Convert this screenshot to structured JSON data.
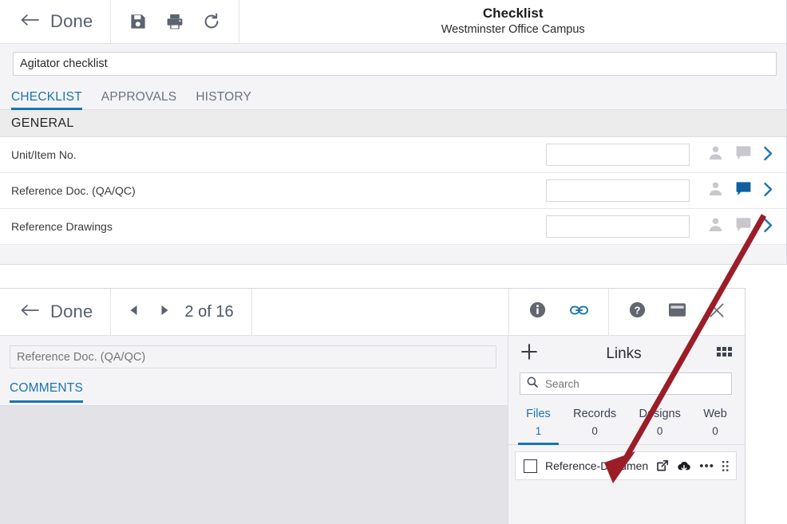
{
  "checklist_panel": {
    "toolbar": {
      "back_icon": "arrow-left-icon",
      "done_label": "Done",
      "save_icon": "save-icon",
      "print_icon": "print-icon",
      "refresh_icon": "refresh-icon"
    },
    "header": {
      "title": "Checklist",
      "subtitle": "Westminster Office Campus"
    },
    "name_field": {
      "value": "Agitator checklist",
      "placeholder": ""
    },
    "tabs": [
      {
        "label": "CHECKLIST",
        "active": true
      },
      {
        "label": "APPROVALS",
        "active": false
      },
      {
        "label": "HISTORY",
        "active": false
      }
    ],
    "section": {
      "title": "GENERAL"
    },
    "rows": [
      {
        "label": "Unit/Item No.",
        "value": "",
        "assignee_icon": "person-icon",
        "comment_icon": "comment-icon",
        "comment_active": false,
        "chevron_icon": "chevron-right-icon"
      },
      {
        "label": "Reference Doc. (QA/QC)",
        "value": "",
        "assignee_icon": "person-icon",
        "comment_icon": "comment-icon",
        "comment_active": true,
        "chevron_icon": "chevron-right-icon"
      },
      {
        "label": "Reference Drawings",
        "value": "",
        "assignee_icon": "person-icon",
        "comment_icon": "comment-icon",
        "comment_active": false,
        "chevron_icon": "chevron-right-icon"
      }
    ]
  },
  "detail_panel": {
    "toolbar": {
      "back_icon": "arrow-left-icon",
      "done_label": "Done",
      "prev_icon": "triangle-left-icon",
      "next_icon": "triangle-right-icon",
      "counter": "2 of 16",
      "info_icon": "info-icon",
      "link_icon": "link-icon",
      "help_icon": "help-icon",
      "panel_icon": "panel-icon",
      "close_icon": "close-icon"
    },
    "item_name_field": {
      "value": "",
      "placeholder": "Reference Doc. (QA/QC)"
    },
    "comments_tab": {
      "label": "COMMENTS",
      "active": true
    },
    "links": {
      "add_icon": "plus-icon",
      "title": "Links",
      "grid_icon": "grid-icon",
      "search": {
        "icon": "search-icon",
        "value": "",
        "placeholder": "Search"
      },
      "tabs": [
        {
          "label": "Files",
          "count": "1",
          "active": true
        },
        {
          "label": "Records",
          "count": "0",
          "active": false
        },
        {
          "label": "Designs",
          "count": "0",
          "active": false
        },
        {
          "label": "Web",
          "count": "0",
          "active": false
        }
      ],
      "files": [
        {
          "checkbox_icon": "checkbox-icon",
          "name": "Reference-Documen...",
          "open_icon": "external-link-icon",
          "download_icon": "cloud-download-icon",
          "more_icon": "ellipsis-icon",
          "drag_icon": "drag-handle-icon"
        }
      ]
    }
  },
  "annotation": {
    "arrow_icon": "annotation-arrow-icon",
    "color": "#9b1d27"
  },
  "colors": {
    "accent_blue": "#1a74b0",
    "comment_active_blue": "#115fa0",
    "icon_gray": "#c7c7cc",
    "section_gray": "#ececec",
    "panel_bg": "#f4f4f7",
    "annotation_red": "#9b1d27"
  }
}
